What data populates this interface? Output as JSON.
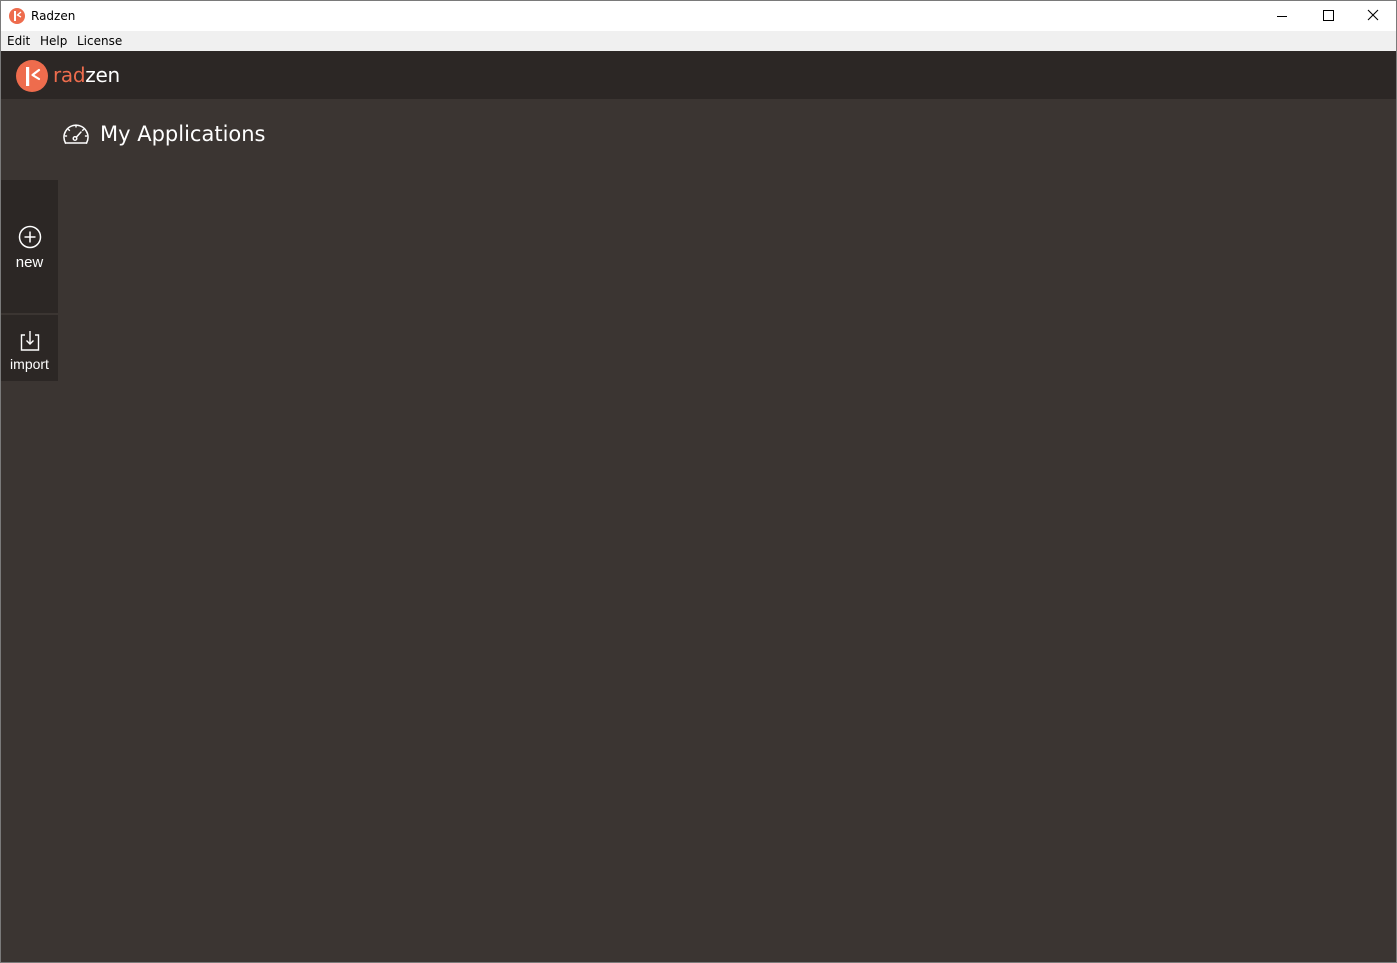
{
  "window": {
    "title": "Radzen",
    "controls": [
      "minimize-icon",
      "maximize-icon",
      "close-icon"
    ]
  },
  "menu": {
    "items": [
      "Edit",
      "Help",
      "License"
    ]
  },
  "header": {
    "logo_part_a": "rad",
    "logo_part_b": "zen",
    "brand_color": "#ee6c4d"
  },
  "page": {
    "title": "My Applications",
    "title_icon": "dashboard-gauge-icon"
  },
  "actions": {
    "new_label": "new",
    "new_icon": "plus-circle-icon",
    "import_label": "import",
    "import_icon": "import-download-icon"
  },
  "colors": {
    "background": "#3b3532",
    "header": "#2c2725",
    "accent": "#ee6c4d"
  }
}
